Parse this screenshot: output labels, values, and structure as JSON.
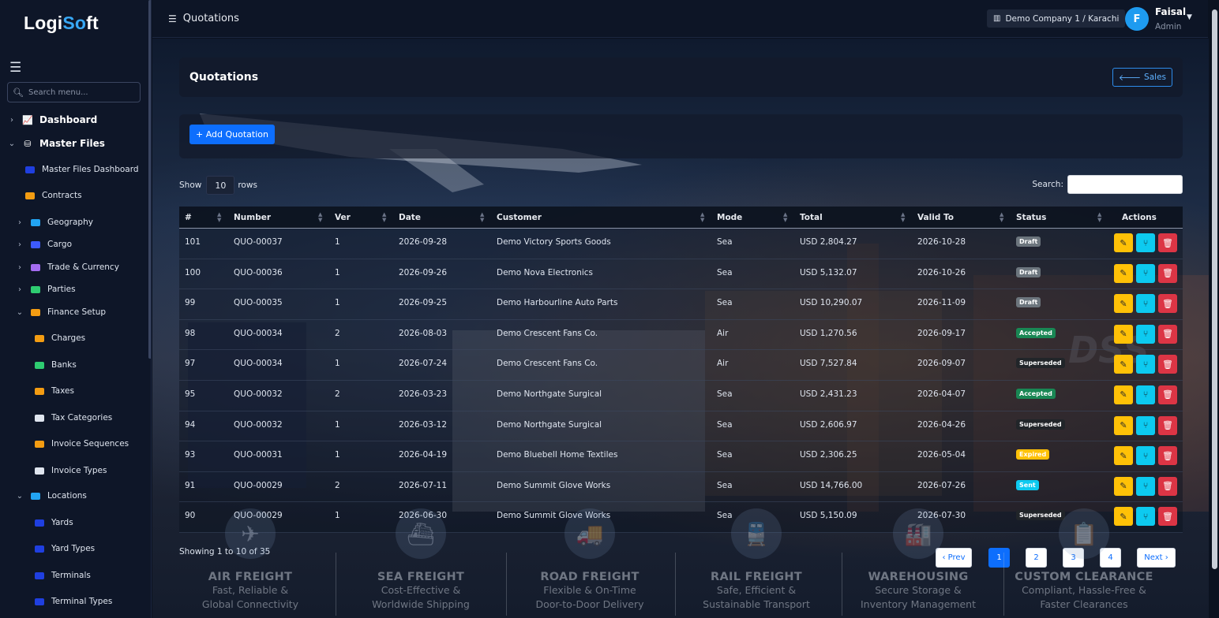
{
  "brand": {
    "left": "Logi",
    "accent": "So",
    "right": "ft"
  },
  "sidebar": {
    "search_placeholder": "Search menu...",
    "items": [
      {
        "label": "Dashboard",
        "chevron": "›",
        "icon": "chart-line-icon",
        "glyph": "📈",
        "color": "#ffffff"
      },
      {
        "label": "Master Files",
        "chevron": "⌄",
        "icon": "database-icon",
        "glyph": "⛁",
        "color": "#ffffff"
      },
      {
        "label": "Master Files Dashboard",
        "icon": "square-icon",
        "color": "#1f3fe0"
      },
      {
        "label": "Contracts",
        "icon": "file-icon",
        "color": "#f39c12"
      },
      {
        "label": "Geography",
        "chevron": "›",
        "icon": "globe-icon",
        "color": "#22a4f2"
      },
      {
        "label": "Cargo",
        "chevron": "›",
        "icon": "box-icon",
        "color": "#3d5afe"
      },
      {
        "label": "Trade & Currency",
        "chevron": "›",
        "icon": "exchange-icon",
        "color": "#a46cf0"
      },
      {
        "label": "Parties",
        "chevron": "›",
        "icon": "users-icon",
        "color": "#2ecc71"
      },
      {
        "label": "Finance Setup",
        "chevron": "⌄",
        "icon": "coins-icon",
        "color": "#f39c12"
      },
      {
        "label": "Charges",
        "icon": "receipt-icon",
        "color": "#f39c12"
      },
      {
        "label": "Banks",
        "icon": "bank-icon",
        "color": "#2ecc71"
      },
      {
        "label": "Taxes",
        "icon": "file-invoice-icon",
        "color": "#f39c12"
      },
      {
        "label": "Tax Categories",
        "icon": "layers-icon",
        "color": "#dfe5ef"
      },
      {
        "label": "Invoice Sequences",
        "icon": "list-ol-icon",
        "color": "#f39c12"
      },
      {
        "label": "Invoice Types",
        "icon": "tag-icon",
        "color": "#dfe5ef"
      },
      {
        "label": "Locations",
        "chevron": "⌄",
        "icon": "warehouse-icon",
        "color": "#22a4f2"
      },
      {
        "label": "Yards",
        "icon": "truck-icon",
        "color": "#1f3fe0"
      },
      {
        "label": "Yard Types",
        "icon": "square-icon",
        "color": "#1f3fe0"
      },
      {
        "label": "Terminals",
        "icon": "square-icon",
        "color": "#1f3fe0"
      },
      {
        "label": "Terminal Types",
        "icon": "truck-icon",
        "color": "#1f3fe0"
      }
    ]
  },
  "topbar": {
    "title": "Quotations",
    "company": "Demo Company 1 / Karachi",
    "avatar_initial": "F",
    "user_name": "Faisal",
    "user_role": "Admin"
  },
  "page": {
    "title": "Quotations",
    "back_button": "Sales",
    "add_button": "+ Add Quotation",
    "show_label": "Show",
    "rows_value": "10",
    "rows_label": "rows",
    "search_label": "Search:",
    "showing_text": "Showing 1 to 10 of 35"
  },
  "table": {
    "columns": [
      "#",
      "Number",
      "Ver",
      "Date",
      "Customer",
      "Mode",
      "Total",
      "Valid To",
      "Status",
      "Actions"
    ],
    "rows": [
      {
        "id": "101",
        "number": "QUO-00037",
        "ver": "1",
        "date": "2026-09-28",
        "customer": "Demo Victory Sports Goods",
        "mode": "Sea",
        "total": "USD 2,804.27",
        "valid_to": "2026-10-28",
        "status": "Draft"
      },
      {
        "id": "100",
        "number": "QUO-00036",
        "ver": "1",
        "date": "2026-09-26",
        "customer": "Demo Nova Electronics",
        "mode": "Sea",
        "total": "USD 5,132.07",
        "valid_to": "2026-10-26",
        "status": "Draft"
      },
      {
        "id": "99",
        "number": "QUO-00035",
        "ver": "1",
        "date": "2026-09-25",
        "customer": "Demo Harbourline Auto Parts",
        "mode": "Sea",
        "total": "USD 10,290.07",
        "valid_to": "2026-11-09",
        "status": "Draft"
      },
      {
        "id": "98",
        "number": "QUO-00034",
        "ver": "2",
        "date": "2026-08-03",
        "customer": "Demo Crescent Fans Co.",
        "mode": "Air",
        "total": "USD 1,270.56",
        "valid_to": "2026-09-17",
        "status": "Accepted"
      },
      {
        "id": "97",
        "number": "QUO-00034",
        "ver": "1",
        "date": "2026-07-24",
        "customer": "Demo Crescent Fans Co.",
        "mode": "Air",
        "total": "USD 7,527.84",
        "valid_to": "2026-09-07",
        "status": "Superseded"
      },
      {
        "id": "95",
        "number": "QUO-00032",
        "ver": "2",
        "date": "2026-03-23",
        "customer": "Demo Northgate Surgical",
        "mode": "Sea",
        "total": "USD 2,431.23",
        "valid_to": "2026-04-07",
        "status": "Accepted"
      },
      {
        "id": "94",
        "number": "QUO-00032",
        "ver": "1",
        "date": "2026-03-12",
        "customer": "Demo Northgate Surgical",
        "mode": "Sea",
        "total": "USD 2,606.97",
        "valid_to": "2026-04-26",
        "status": "Superseded"
      },
      {
        "id": "93",
        "number": "QUO-00031",
        "ver": "1",
        "date": "2026-04-19",
        "customer": "Demo Bluebell Home Textiles",
        "mode": "Sea",
        "total": "USD 2,306.25",
        "valid_to": "2026-05-04",
        "status": "Expired"
      },
      {
        "id": "91",
        "number": "QUO-00029",
        "ver": "2",
        "date": "2026-07-11",
        "customer": "Demo Summit Glove Works",
        "mode": "Sea",
        "total": "USD 14,766.00",
        "valid_to": "2026-07-26",
        "status": "Sent"
      },
      {
        "id": "90",
        "number": "QUO-00029",
        "ver": "1",
        "date": "2026-06-30",
        "customer": "Demo Summit Glove Works",
        "mode": "Sea",
        "total": "USD 5,150.09",
        "valid_to": "2026-07-30",
        "status": "Superseded"
      }
    ]
  },
  "status_colors": {
    "Draft": "#6c757d",
    "Accepted": "#198754",
    "Superseded": "#212529",
    "Expired": "#ffc107",
    "Sent": "#0dcaf0"
  },
  "pagination": {
    "prev": "‹ Prev",
    "pages": [
      "1",
      "2",
      "3",
      "4"
    ],
    "active": "1",
    "next": "Next ›"
  },
  "services": [
    {
      "title": "AIR FREIGHT",
      "line1": "Fast, Reliable &",
      "line2": "Global Connectivity",
      "icon": "plane-icon",
      "glyph": "✈"
    },
    {
      "title": "SEA FREIGHT",
      "line1": "Cost-Effective &",
      "line2": "Worldwide Shipping",
      "icon": "ship-icon",
      "glyph": "⛴"
    },
    {
      "title": "ROAD FREIGHT",
      "line1": "Flexible & On-Time",
      "line2": "Door-to-Door Delivery",
      "icon": "truck-icon",
      "glyph": "🚚"
    },
    {
      "title": "RAIL FREIGHT",
      "line1": "Safe, Efficient &",
      "line2": "Sustainable Transport",
      "icon": "train-icon",
      "glyph": "🚆"
    },
    {
      "title": "WAREHOUSING",
      "line1": "Secure Storage &",
      "line2": "Inventory Management",
      "icon": "warehouse-icon",
      "glyph": "🏭"
    },
    {
      "title": "CUSTOM CLEARANCE",
      "line1": "Compliant, Hassle-Free &",
      "line2": "Faster Clearances",
      "icon": "clipboard-check-icon",
      "glyph": "📋"
    }
  ],
  "watermark": "DSS"
}
